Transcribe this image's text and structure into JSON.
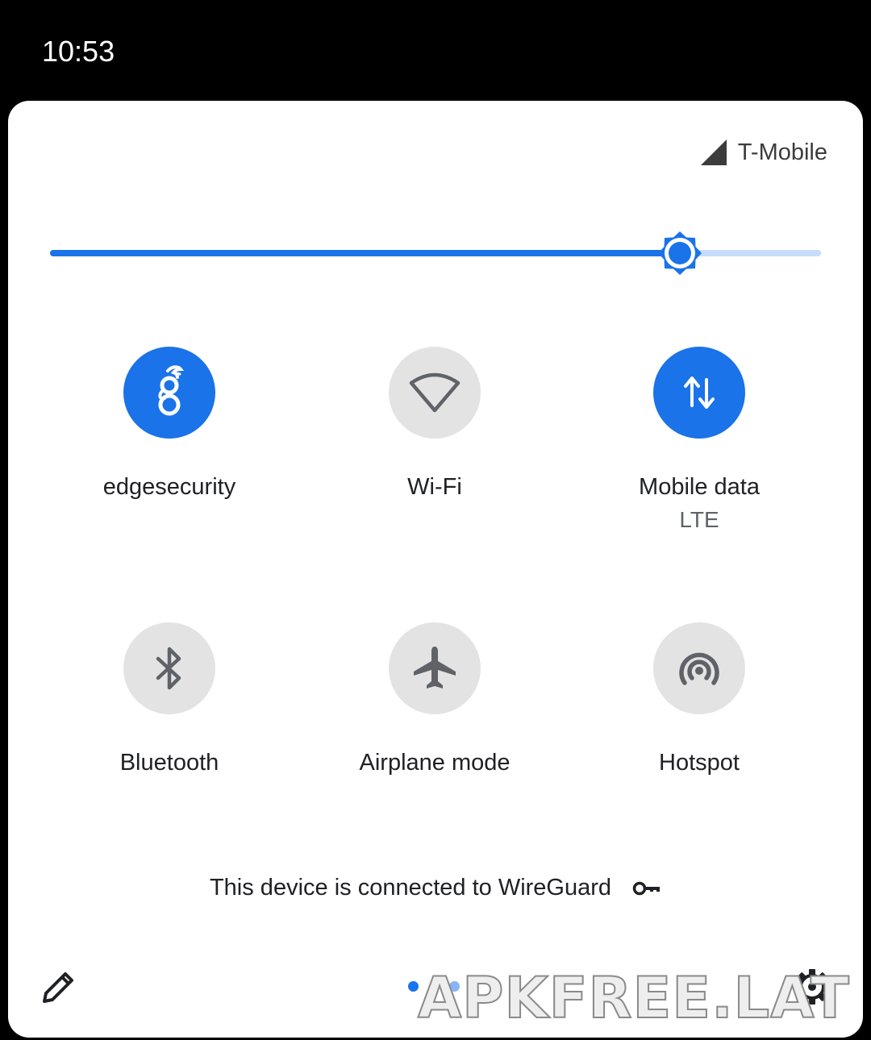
{
  "status_bar": {
    "time": "10:53"
  },
  "carrier": {
    "name": "T-Mobile",
    "icon": "signal-icon"
  },
  "brightness": {
    "level": 0.817,
    "icon": "brightness-icon"
  },
  "tiles": [
    {
      "id": "vpn",
      "label": "edgesecurity",
      "sublabel": "",
      "state": "on",
      "icon": "wireguard-icon"
    },
    {
      "id": "wifi",
      "label": "Wi-Fi",
      "sublabel": "",
      "state": "off",
      "icon": "wifi-icon"
    },
    {
      "id": "mobile-data",
      "label": "Mobile data",
      "sublabel": "LTE",
      "state": "on",
      "icon": "mobile-data-icon"
    },
    {
      "id": "bluetooth",
      "label": "Bluetooth",
      "sublabel": "",
      "state": "off",
      "icon": "bluetooth-icon"
    },
    {
      "id": "airplane",
      "label": "Airplane mode",
      "sublabel": "",
      "state": "off",
      "icon": "airplane-icon"
    },
    {
      "id": "hotspot",
      "label": "Hotspot",
      "sublabel": "",
      "state": "off",
      "icon": "hotspot-icon"
    }
  ],
  "footer": {
    "vpn_message": "This device is connected to WireGuard",
    "key_icon": "key-icon"
  },
  "bottom_bar": {
    "edit_icon": "pencil-icon",
    "settings_icon": "gear-icon",
    "pages": 2,
    "current_page": 1
  },
  "watermark": "APKFREE.LAT",
  "colors": {
    "accent": "#1a73e8",
    "accent_light": "#c6dcfb",
    "tile_off": "#e3e3e3",
    "icon_off": "#5f6368",
    "panel": "#ffffff",
    "background": "#000000"
  }
}
